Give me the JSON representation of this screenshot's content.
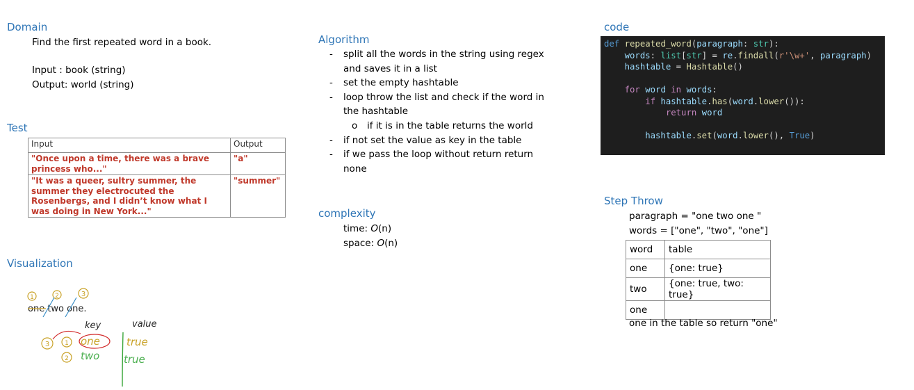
{
  "domain": {
    "heading": "Domain",
    "description": "Find the first repeated word in a book.",
    "input": "Input : book (string)",
    "output": "Output: world (string)"
  },
  "test": {
    "heading": "Test",
    "columns": [
      "Input",
      "Output"
    ],
    "rows": [
      [
        "\"Once upon a time, there was a brave princess who...\"",
        "\"a\""
      ],
      [
        "\"It was a queer, sultry summer, the summer they electrocuted the Rosenbergs, and I didn’t know what I was doing in New York...\"",
        "\"summer\""
      ]
    ]
  },
  "visualization": {
    "heading": "Visualization",
    "sentence": "one two one.",
    "markers": [
      "1",
      "2",
      "3"
    ],
    "key_label": "key",
    "value_label": "value",
    "keys": [
      "one",
      "two"
    ],
    "key_markers": [
      "3",
      "1",
      "2"
    ],
    "values": [
      "true",
      "true"
    ]
  },
  "algorithm": {
    "heading": "Algorithm",
    "steps": [
      "split all the words in the string using regex and saves it in a list",
      "set the empty hashtable",
      "loop throw the list and check if the word in the hashtable"
    ],
    "substep": "if it is in the table returns the world",
    "steps_after": [
      "if not set the value as key in the table",
      "if we pass the loop without return return none"
    ]
  },
  "complexity": {
    "heading": "complexity",
    "time_label": "time:",
    "time_value": "O",
    "time_arg": "(n)",
    "space_label": "space:",
    "space_value": "O",
    "space_arg": "(n)"
  },
  "code": {
    "heading": "code",
    "lines": [
      "def repeated_word(paragraph: str):",
      "    words: list[str] = re.findall(r'\\w+', paragraph)",
      "    hashtable = Hashtable()",
      "",
      "    for word in words:",
      "        if hashtable.has(word.lower()):",
      "            return word",
      "",
      "        hashtable.set(word.lower(), True)"
    ]
  },
  "step_throw": {
    "heading": "Step Throw",
    "paragraph_line": "paragraph = \"one two one \"",
    "words_line": "words = [\"one\", \"two\", \"one\"]",
    "columns": [
      "word",
      "table"
    ],
    "rows": [
      [
        "one",
        "{one: true}"
      ],
      [
        "two",
        "{one: true, two: true}"
      ],
      [
        "one",
        ""
      ]
    ],
    "conclusion": "one in the table so return \"one\""
  }
}
